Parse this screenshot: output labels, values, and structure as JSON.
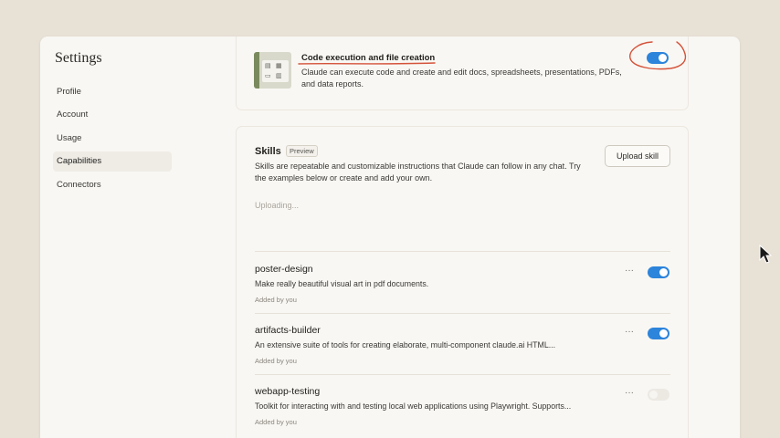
{
  "settings": {
    "title": "Settings"
  },
  "nav": {
    "items": [
      {
        "label": "Profile"
      },
      {
        "label": "Account"
      },
      {
        "label": "Usage"
      },
      {
        "label": "Capabilities",
        "active": true
      },
      {
        "label": "Connectors"
      }
    ]
  },
  "feature": {
    "title": "Code execution and file creation",
    "description": "Claude can execute code and create and edit docs, spreadsheets, presentations, PDFs, and data reports.",
    "enabled": true,
    "thumbnail_icons": [
      "document-icon",
      "spreadsheet-icon",
      "folder-icon",
      "chart-icon"
    ]
  },
  "skills": {
    "title": "Skills",
    "badge": "Preview",
    "description": "Skills are repeatable and customizable instructions that Claude can follow in any chat. Try the examples below or create and add your own.",
    "upload_label": "Upload skill",
    "status": "Uploading...",
    "list": [
      {
        "name": "poster-design",
        "description": "Make really beautiful visual art in pdf documents.",
        "meta": "Added by you",
        "enabled": true
      },
      {
        "name": "artifacts-builder",
        "description": "An extensive suite of tools for creating elaborate, multi-component claude.ai HTML...",
        "meta": "Added by you",
        "enabled": true
      },
      {
        "name": "webapp-testing",
        "description": "Toolkit for interacting with and testing local web applications using Playwright. Supports...",
        "meta": "Added by you",
        "enabled": false
      }
    ],
    "more_label": "···"
  },
  "colors": {
    "accent": "#2c84db",
    "annotation": "#d4523a",
    "background": "#e8e1d6",
    "panel": "#f9f7f3"
  }
}
